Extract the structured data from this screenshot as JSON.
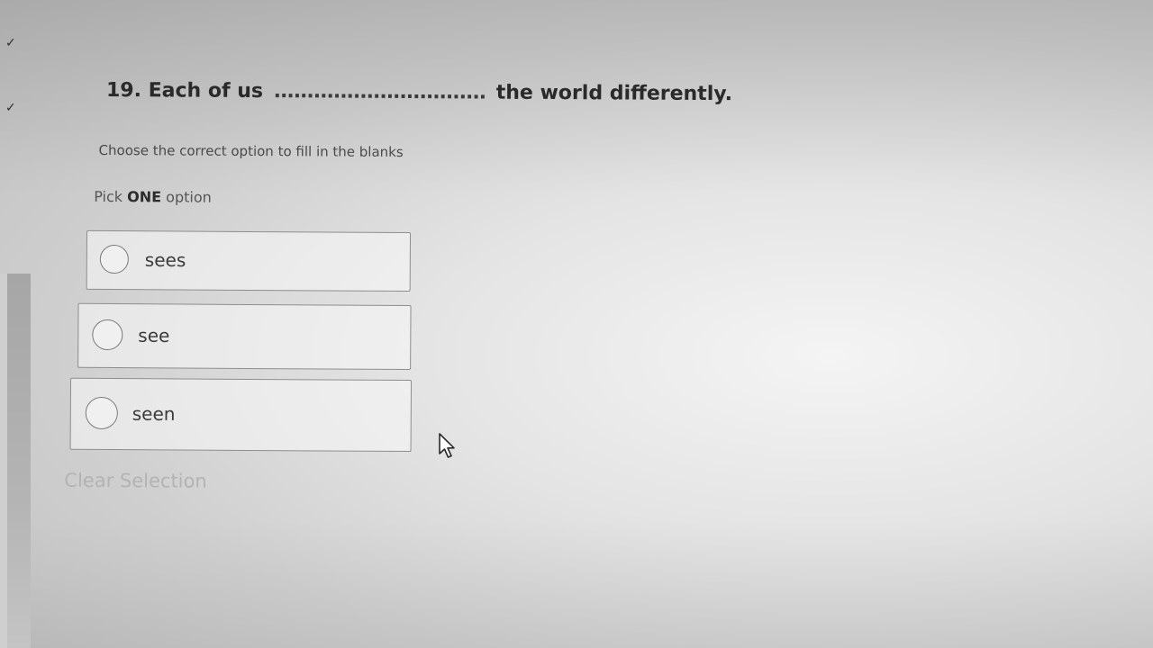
{
  "question": {
    "number": "19.",
    "before_blank": "Each of us",
    "blank": "................................",
    "after_blank": "the world differently."
  },
  "instruction": "Choose the correct option to fill in the blanks",
  "pick": {
    "prefix": "Pick",
    "emphasis": "ONE",
    "suffix": "option"
  },
  "options": [
    {
      "label": "sees",
      "selected": false
    },
    {
      "label": "see",
      "selected": false
    },
    {
      "label": "seen",
      "selected": false
    }
  ],
  "clear_label": "Clear Selection",
  "sidebar": {
    "checks": [
      "✓",
      "✓"
    ]
  },
  "icons": {
    "cursor": "mouse-pointer-icon",
    "radio": "radio-circle-icon",
    "check": "checkmark-icon"
  }
}
